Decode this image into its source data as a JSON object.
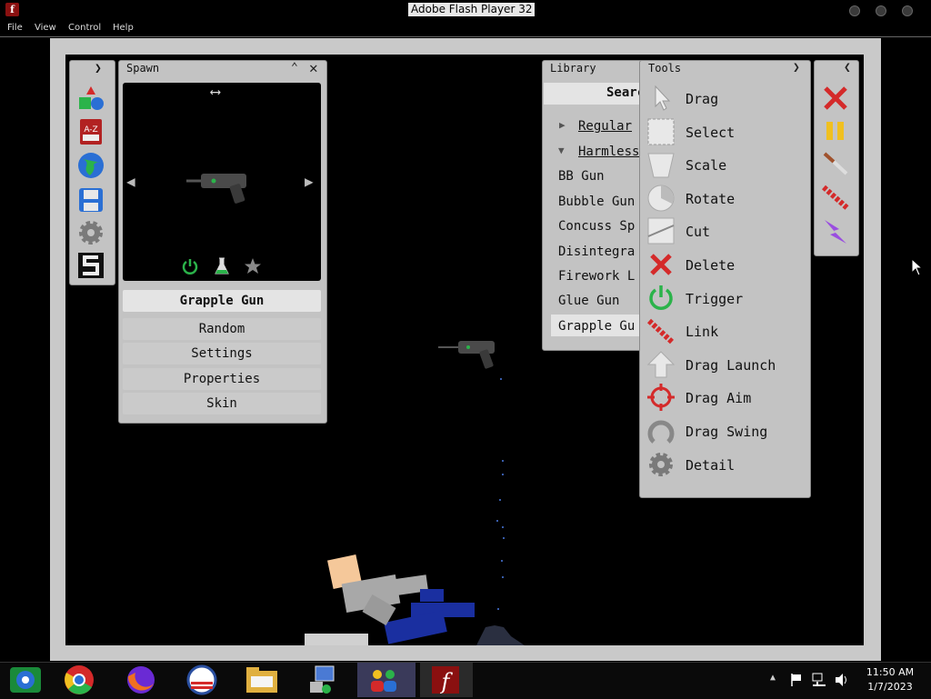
{
  "window": {
    "title": "Adobe Flash Player 32"
  },
  "menu": {
    "items": [
      "File",
      "View",
      "Control",
      "Help"
    ]
  },
  "spawn": {
    "title": "Spawn",
    "selected_item": "Grapple Gun",
    "buttons": [
      "Random",
      "Settings",
      "Properties",
      "Skin"
    ]
  },
  "library": {
    "title": "Library",
    "search_label": "Searc",
    "categories": [
      "Regular",
      "Harmless"
    ],
    "items": [
      "BB Gun",
      "Bubble Gun",
      "Concuss Sp",
      "Disintegra",
      "Firework L",
      "Glue Gun",
      "Grapple Gu"
    ]
  },
  "tools": {
    "title": "Tools",
    "items": [
      "Drag",
      "Select",
      "Scale",
      "Rotate",
      "Cut",
      "Delete",
      "Trigger",
      "Link",
      "Drag Launch",
      "Drag Aim",
      "Drag Swing",
      "Detail"
    ]
  },
  "taskbar": {
    "time": "11:50 AM",
    "date": "1/7/2023"
  },
  "colors": {
    "panel": "#c3c3c3",
    "stage": "#000000",
    "trigger_green": "#2bb34a",
    "delete_red": "#d42a2a"
  }
}
